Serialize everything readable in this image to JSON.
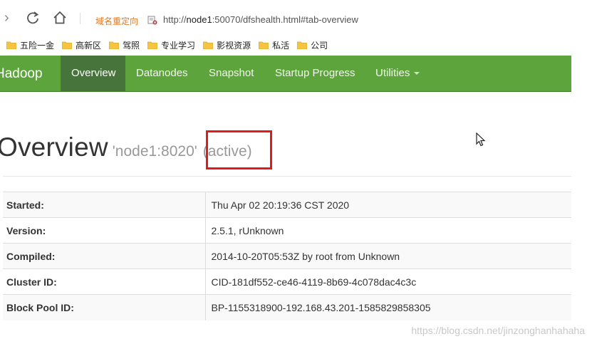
{
  "browser": {
    "redirect_label": "域名重定向",
    "url_prefix": "http://",
    "url_host": "node1",
    "url_rest": ":50070/dfshealth.html#tab-overview"
  },
  "bookmarks": [
    {
      "label": "五险一金"
    },
    {
      "label": "高新区"
    },
    {
      "label": "驾照"
    },
    {
      "label": "专业学习"
    },
    {
      "label": "影视资源"
    },
    {
      "label": "私活"
    },
    {
      "label": "公司"
    }
  ],
  "navbar": {
    "brand": "Hadoop",
    "items": [
      {
        "label": "Overview",
        "active": true
      },
      {
        "label": "Datanodes"
      },
      {
        "label": "Snapshot"
      },
      {
        "label": "Startup Progress"
      },
      {
        "label": "Utilities"
      }
    ]
  },
  "page": {
    "title": "Overview",
    "subtitle_host": "'node1:8020'",
    "subtitle_state": "(active)"
  },
  "overview": {
    "rows": [
      {
        "key": "Started:",
        "value": "Thu Apr 02 20:19:36 CST 2020"
      },
      {
        "key": "Version:",
        "value": "2.5.1, rUnknown"
      },
      {
        "key": "Compiled:",
        "value": "2014-10-20T05:53Z by root from Unknown"
      },
      {
        "key": "Cluster ID:",
        "value": "CID-181df552-ce46-4119-8b69-4c078dac4c3c"
      },
      {
        "key": "Block Pool ID:",
        "value": "BP-1155318900-192.168.43.201-1585829858305"
      }
    ]
  },
  "watermark": "https://blog.csdn.net/jinzonghanhahaha",
  "colors": {
    "navbar": "#5da43c",
    "navbar_active": "#46743a",
    "highlight_box": "#e01b1b",
    "redirect_text": "#e07a2a"
  }
}
